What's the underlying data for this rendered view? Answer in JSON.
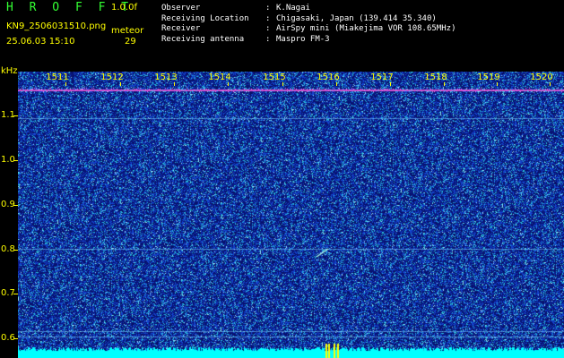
{
  "header": {
    "app_title": "H R O F F T",
    "version": "1.0.0f",
    "filename": "KN9_2506031510.png",
    "datetime": "25.06.03 15:10",
    "meteor_label": "meteor",
    "meteor_count": "29"
  },
  "info": [
    {
      "key": "Observer",
      "value": "K.Nagai"
    },
    {
      "key": "Receiving Location",
      "value": "Chigasaki, Japan (139.414 35.340)"
    },
    {
      "key": "Receiver",
      "value": "AirSpy mini (Miakejima VOR 108.65MHz)"
    },
    {
      "key": "Receiving antenna",
      "value": "Maspro FM-3"
    }
  ],
  "axes": {
    "y_unit": "kHz",
    "y_ticks": [
      "1.1",
      "1.0",
      "0.9",
      "0.8",
      "0.7",
      "0.6"
    ],
    "x_ticks": [
      "1511",
      "1512",
      "1513",
      "1514",
      "1515",
      "1516",
      "1517",
      "1518",
      "1519",
      "1520"
    ]
  },
  "colors": {
    "background": "#000000",
    "label_yellow": "#ffff00",
    "title_green": "#33ff33",
    "spectrogram_base": "#0d1a80",
    "carrier_magenta": "#d050d0",
    "baseline_cyan": "#00ffff"
  }
}
